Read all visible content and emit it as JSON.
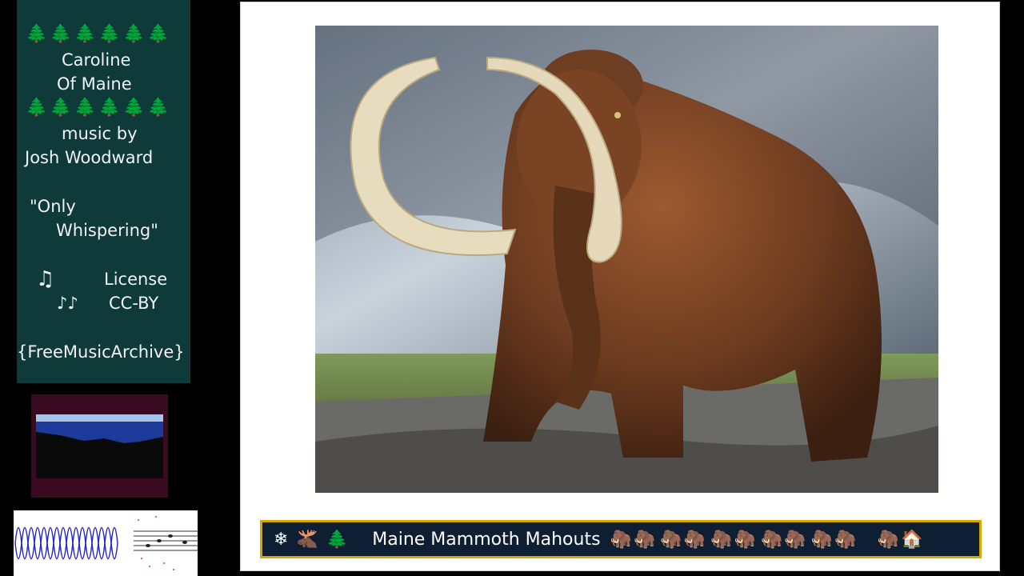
{
  "info": {
    "trees": "🌲🌲🌲🌲🌲🌲",
    "title_line1": "Caroline",
    "title_line2": "Of Maine",
    "byline1": "music by",
    "byline2": "Josh Woodward",
    "song_line1": "\"Only",
    "song_line2": "Whispering\"",
    "note1": "♫",
    "note2": "♪♪",
    "license_label": "License",
    "license_value": "CC-BY",
    "source": "{FreeMusicArchive}"
  },
  "ticker": {
    "icons_left": [
      "❄",
      "🫎",
      "🌲"
    ],
    "caption": "Maine Mammoth Mahouts",
    "icons_right": [
      "🦣",
      "🦣",
      "🦣",
      "🦣",
      "🦣",
      "🦣",
      "🦣",
      "🦣",
      "🦣",
      "🦣",
      "🦣",
      "🏠"
    ]
  },
  "colors": {
    "panel": "#0e3a3a",
    "ticker_bg": "#0f1f33",
    "ticker_border": "#d9a800"
  }
}
